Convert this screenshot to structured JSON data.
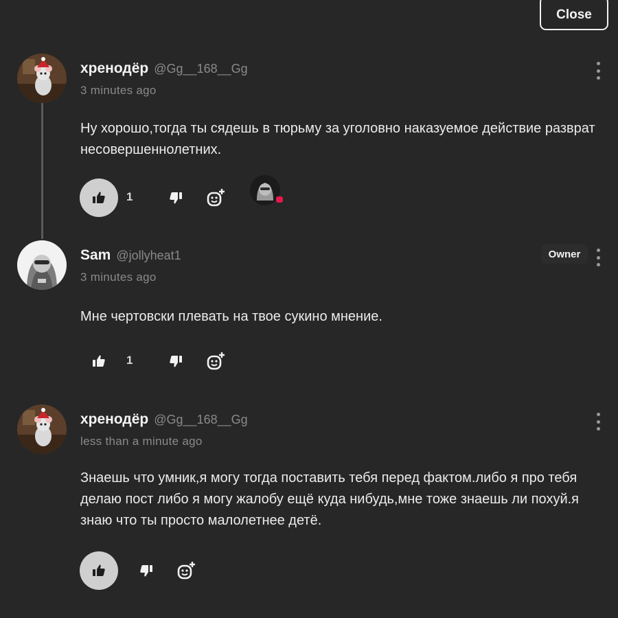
{
  "header": {
    "close_label": "Close"
  },
  "comments": [
    {
      "author": "хренодёр",
      "handle": "@Gg__168__Gg",
      "time": "3 minutes ago",
      "text": "Ну хорошо,тогда ты сядешь в тюрьму за уголовно наказуемое действие разврат несовершеннолетних.",
      "likes": "1",
      "liked": true,
      "avatar_icon": "rat-avatar-icon"
    },
    {
      "author": "Sam",
      "handle": "@jollyheat1",
      "badge": "Owner",
      "time": "3 minutes ago",
      "text": "Мне чертовски плевать на твое сукино мнение.",
      "likes": "1",
      "liked": false,
      "avatar_icon": "hooded-figure-avatar-icon"
    },
    {
      "author": "хренодёр",
      "handle": "@Gg__168__Gg",
      "time": "less than a minute ago",
      "text": "Знаешь что умник,я могу тогда поставить тебя перед фактом.либо я про тебя делаю пост либо я могу жалобу ещё куда нибудь,мне тоже знаешь ли похуй.я знаю что ты просто малолетнее детё.",
      "liked": true,
      "avatar_icon": "rat-avatar-icon"
    }
  ],
  "colors": {
    "background": "#272727",
    "text": "#ececec",
    "muted": "#8a8a8a",
    "like_filled_bg": "#cfcfcf",
    "notification_dot": "#e8194b"
  },
  "icons": [
    "thumbs-up-icon",
    "thumbs-down-icon",
    "add-reaction-icon",
    "more-vertical-icon"
  ]
}
